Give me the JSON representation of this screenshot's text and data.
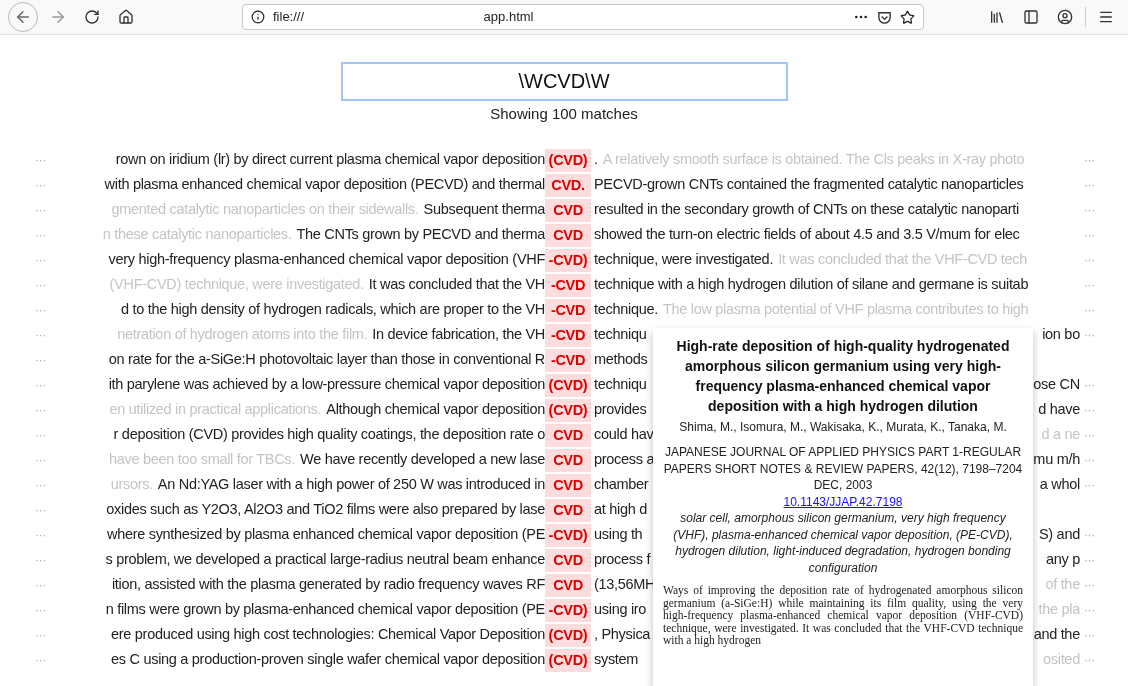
{
  "browser": {
    "url_scheme": "file:///",
    "url_page": "app.html"
  },
  "search": {
    "value": "\\WCVD\\W"
  },
  "status": "Showing 100 matches",
  "rows": [
    {
      "lead": "···",
      "pre": "rown on iridium (lr) by direct current plasma chemical vapor deposition",
      "match": "(CVD)",
      "post": ".",
      "post_faded": "A relatively smooth surface is obtained. The Cls peaks in X-ray photo",
      "trail": "···"
    },
    {
      "lead": "···",
      "pre": "with plasma enhanced chemical vapor deposition (PECVD) and thermal",
      "match": "CVD.",
      "post": "PECVD-grown CNTs contained the fragmented catalytic nanoparticles",
      "trail": "···"
    },
    {
      "lead": "···",
      "pre_faded": "gmented catalytic nanoparticles on their sidewalls.",
      "pre": "Subsequent therma",
      "match": "CVD",
      "post": "resulted in the secondary growth of CNTs on these catalytic nanoparti",
      "trail": "···"
    },
    {
      "lead": "···",
      "pre_faded": "n these catalytic nanoparticles.",
      "pre": "The CNTs grown by PECVD and therma",
      "match": "CVD",
      "post": "showed the turn-on electric fields of about 4.5 and 3.5 V/mum for elec",
      "trail": "···"
    },
    {
      "lead": "···",
      "pre": "very high-frequency plasma-enhanced chemical vapor deposition (VHF",
      "match": "-CVD)",
      "post": "technique, were investigated.",
      "post_faded": "It was concluded that the VHF-CVD tech",
      "trail": "···"
    },
    {
      "lead": "···",
      "pre_faded": "(VHF-CVD) technique, were investigated.",
      "pre": "It was concluded that the VH",
      "match": "-CVD",
      "post": "technique with a high hydrogen dilution of silane and germane is suitab",
      "trail": "···"
    },
    {
      "lead": "···",
      "pre": "d to the high density of hydrogen radicals, which are proper to the VH",
      "match": "-CVD",
      "post": "technique.",
      "post_faded": "The low plasma potential of VHF plasma contributes to high",
      "trail": "···"
    },
    {
      "lead": "···",
      "pre_faded": "netration of hydrogen atoms into the film.",
      "pre": "In device fabrication, the VH",
      "match": "-CVD",
      "post": "techniqu",
      "beyond": "ion bo",
      "beyond_faded": false,
      "trail": "···"
    },
    {
      "lead": "···",
      "pre": "on rate for the a-SiGe:H photovoltaic layer than those in conventional R",
      "match": "-CVD",
      "post": "methods"
    },
    {
      "lead": "···",
      "pre": "ith parylene was achieved by a low-pressure chemical vapor deposition",
      "match": "(CVD)",
      "post": "techniqu",
      "beyond": "ose CN",
      "beyond_faded": false,
      "trail": "···"
    },
    {
      "lead": "···",
      "pre_faded": "en utilized in practical applications.",
      "pre": "Although chemical vapor deposition",
      "match": "(CVD)",
      "post": "provides",
      "beyond": "d have",
      "beyond_faded": false,
      "trail": "···"
    },
    {
      "lead": "···",
      "pre": "r deposition (CVD) provides high quality coatings, the deposition rate o",
      "match": "CVD",
      "post": "could hav",
      "beyond": "d a ne",
      "beyond_faded": true,
      "trail": "···"
    },
    {
      "lead": "···",
      "pre_faded": "have been too small for TBCs.",
      "pre": "We have recently developed a new lase",
      "match": "CVD",
      "post": "process a",
      "beyond": "mu m/h",
      "beyond_faded": false,
      "trail": "···"
    },
    {
      "lead": "···",
      "pre_faded": "ursors.",
      "pre": "An Nd:YAG laser with a high power of 250 W was introduced in",
      "match": "CVD",
      "post": "chamber",
      "beyond": "a whol",
      "beyond_faded": false,
      "trail": "···"
    },
    {
      "lead": "···",
      "pre": "oxides such as Y2O3, Al2O3 and TiO2 films were also prepared by lase",
      "match": "CVD",
      "post": "at high d"
    },
    {
      "lead": "···",
      "pre": "where synthesized by plasma enhanced chemical vapor deposition (PE",
      "match": "-CVD)",
      "post": "using th",
      "beyond": "S) and",
      "beyond_faded": false,
      "trail": "···"
    },
    {
      "lead": "···",
      "pre": "s problem, we developed a practical large-radius neutral beam enhance",
      "match": "CVD",
      "post": "process f",
      "beyond": "any p",
      "beyond_faded": false,
      "trail": "···"
    },
    {
      "lead": "···",
      "pre": "ition, assisted with the plasma generated by radio frequency waves RF",
      "match": "CVD",
      "post": "(13,56MH",
      "beyond": "of the",
      "beyond_faded": true,
      "trail": "···"
    },
    {
      "lead": "···",
      "pre": "n films were grown by plasma-enhanced chemical vapor deposition (PE",
      "match": "-CVD)",
      "post": "using iro",
      "beyond": "the pla",
      "beyond_faded": true,
      "trail": "···"
    },
    {
      "lead": "···",
      "pre": "ere produced using high cost technologies: Chemical Vapor Deposition",
      "match": "(CVD)",
      "post": ", Physica",
      "beyond": "and the",
      "beyond_faded": false,
      "trail": "···"
    },
    {
      "lead": "···",
      "pre": "es C using a production-proven single wafer chemical vapor deposition",
      "match": "(CVD)",
      "post": "system",
      "beyond": "osited",
      "beyond_faded": true,
      "trail": "···"
    }
  ],
  "popup": {
    "title": "High-rate deposition of high-quality hydrogenated amorphous silicon germanium using very high-frequency plasma-enhanced chemical vapor deposition with a high hydrogen dilution",
    "authors": "Shima, M., Isomura, M., Wakisaka, K., Murata, K., Tanaka, M.",
    "journal": "JAPANESE JOURNAL OF APPLIED PHYSICS PART 1-REGULAR PAPERS SHORT NOTES & REVIEW PAPERS, 42(12), 7198–7204 DEC, 2003",
    "doi": "10.1143/JJAP.42.7198",
    "keywords": "solar cell, amorphous silicon germanium, very high frequency (VHF), plasma-enhanced chemical vapor deposition, (PE-CVD), hydrogen dilution, light-induced degradation, hydrogen bonding configuration",
    "abstract": "Ways of improving the deposition rate of hydrogenated amorphous silicon germanium (a-SiGe:H) while maintaining its film quality, using the very high-frequency plasma-enhanced chemical vapor deposition (VHF-CVD) technique, were investigated. It was concluded that the VHF-CVD technique with a high hydrogen"
  }
}
